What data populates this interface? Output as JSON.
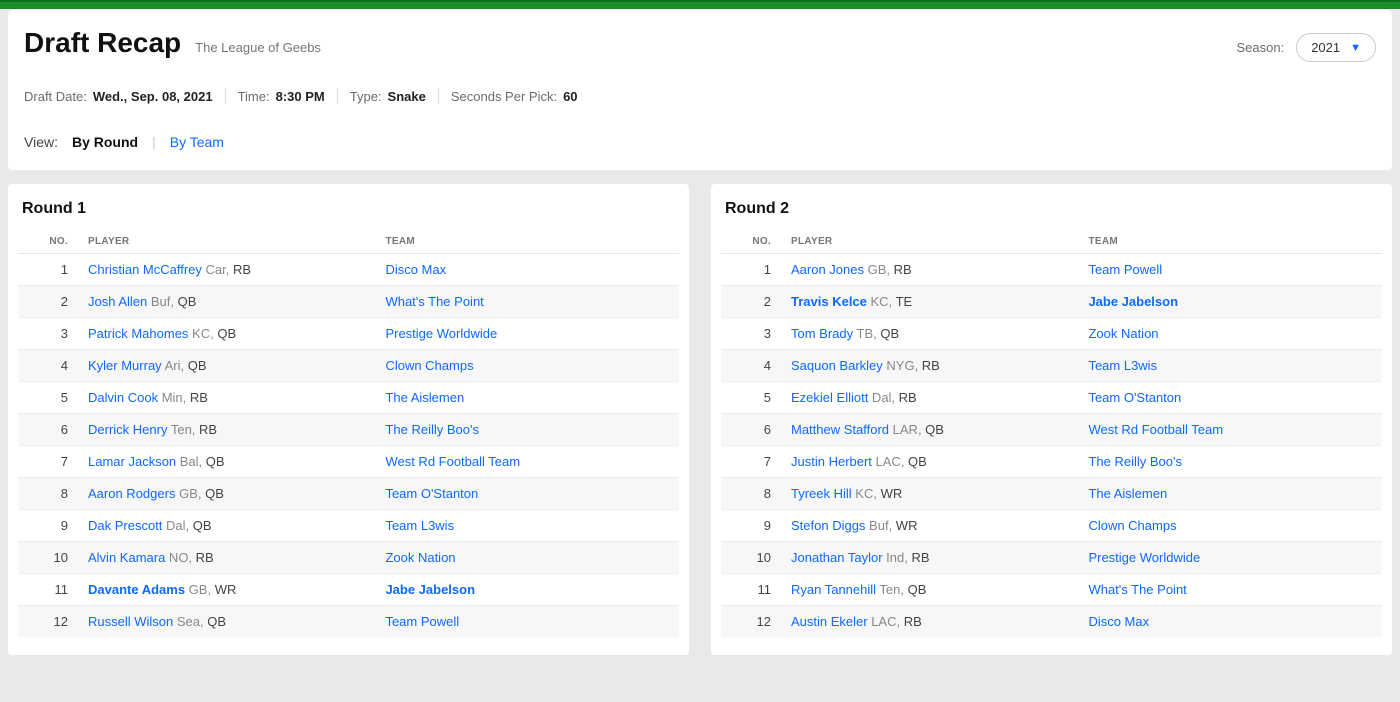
{
  "header": {
    "title": "Draft Recap",
    "league": "The League of Geebs",
    "season_label": "Season:",
    "season_value": "2021",
    "meta": {
      "date_label": "Draft Date:",
      "date_value": "Wed., Sep. 08, 2021",
      "time_label": "Time:",
      "time_value": "8:30 PM",
      "type_label": "Type:",
      "type_value": "Snake",
      "spp_label": "Seconds Per Pick:",
      "spp_value": "60"
    },
    "view": {
      "label": "View:",
      "by_round": "By Round",
      "by_team": "By Team"
    }
  },
  "columns": {
    "no": "NO.",
    "player": "PLAYER",
    "team": "TEAM"
  },
  "rounds": [
    {
      "title": "Round 1",
      "picks": [
        {
          "no": 1,
          "player": "Christian McCaffrey",
          "nfl": "Car",
          "pos": "RB",
          "team": "Disco Max",
          "highlight": false
        },
        {
          "no": 2,
          "player": "Josh Allen",
          "nfl": "Buf",
          "pos": "QB",
          "team": "What's The Point",
          "highlight": false
        },
        {
          "no": 3,
          "player": "Patrick Mahomes",
          "nfl": "KC",
          "pos": "QB",
          "team": "Prestige Worldwide",
          "highlight": false
        },
        {
          "no": 4,
          "player": "Kyler Murray",
          "nfl": "Ari",
          "pos": "QB",
          "team": "Clown Champs",
          "highlight": false
        },
        {
          "no": 5,
          "player": "Dalvin Cook",
          "nfl": "Min",
          "pos": "RB",
          "team": "The Aislemen",
          "highlight": false
        },
        {
          "no": 6,
          "player": "Derrick Henry",
          "nfl": "Ten",
          "pos": "RB",
          "team": "The Reilly Boo's",
          "highlight": false
        },
        {
          "no": 7,
          "player": "Lamar Jackson",
          "nfl": "Bal",
          "pos": "QB",
          "team": "West Rd Football Team",
          "highlight": false
        },
        {
          "no": 8,
          "player": "Aaron Rodgers",
          "nfl": "GB",
          "pos": "QB",
          "team": "Team O'Stanton",
          "highlight": false
        },
        {
          "no": 9,
          "player": "Dak Prescott",
          "nfl": "Dal",
          "pos": "QB",
          "team": "Team L3wis",
          "highlight": false
        },
        {
          "no": 10,
          "player": "Alvin Kamara",
          "nfl": "NO",
          "pos": "RB",
          "team": "Zook Nation",
          "highlight": false
        },
        {
          "no": 11,
          "player": "Davante Adams",
          "nfl": "GB",
          "pos": "WR",
          "team": "Jabe Jabelson",
          "highlight": true
        },
        {
          "no": 12,
          "player": "Russell Wilson",
          "nfl": "Sea",
          "pos": "QB",
          "team": "Team Powell",
          "highlight": false
        }
      ]
    },
    {
      "title": "Round 2",
      "picks": [
        {
          "no": 1,
          "player": "Aaron Jones",
          "nfl": "GB",
          "pos": "RB",
          "team": "Team Powell",
          "highlight": false
        },
        {
          "no": 2,
          "player": "Travis Kelce",
          "nfl": "KC",
          "pos": "TE",
          "team": "Jabe Jabelson",
          "highlight": true
        },
        {
          "no": 3,
          "player": "Tom Brady",
          "nfl": "TB",
          "pos": "QB",
          "team": "Zook Nation",
          "highlight": false
        },
        {
          "no": 4,
          "player": "Saquon Barkley",
          "nfl": "NYG",
          "pos": "RB",
          "team": "Team L3wis",
          "highlight": false
        },
        {
          "no": 5,
          "player": "Ezekiel Elliott",
          "nfl": "Dal",
          "pos": "RB",
          "team": "Team O'Stanton",
          "highlight": false
        },
        {
          "no": 6,
          "player": "Matthew Stafford",
          "nfl": "LAR",
          "pos": "QB",
          "team": "West Rd Football Team",
          "highlight": false
        },
        {
          "no": 7,
          "player": "Justin Herbert",
          "nfl": "LAC",
          "pos": "QB",
          "team": "The Reilly Boo's",
          "highlight": false
        },
        {
          "no": 8,
          "player": "Tyreek Hill",
          "nfl": "KC",
          "pos": "WR",
          "team": "The Aislemen",
          "highlight": false
        },
        {
          "no": 9,
          "player": "Stefon Diggs",
          "nfl": "Buf",
          "pos": "WR",
          "team": "Clown Champs",
          "highlight": false
        },
        {
          "no": 10,
          "player": "Jonathan Taylor",
          "nfl": "Ind",
          "pos": "RB",
          "team": "Prestige Worldwide",
          "highlight": false
        },
        {
          "no": 11,
          "player": "Ryan Tannehill",
          "nfl": "Ten",
          "pos": "QB",
          "team": "What's The Point",
          "highlight": false
        },
        {
          "no": 12,
          "player": "Austin Ekeler",
          "nfl": "LAC",
          "pos": "RB",
          "team": "Disco Max",
          "highlight": false
        }
      ]
    }
  ]
}
